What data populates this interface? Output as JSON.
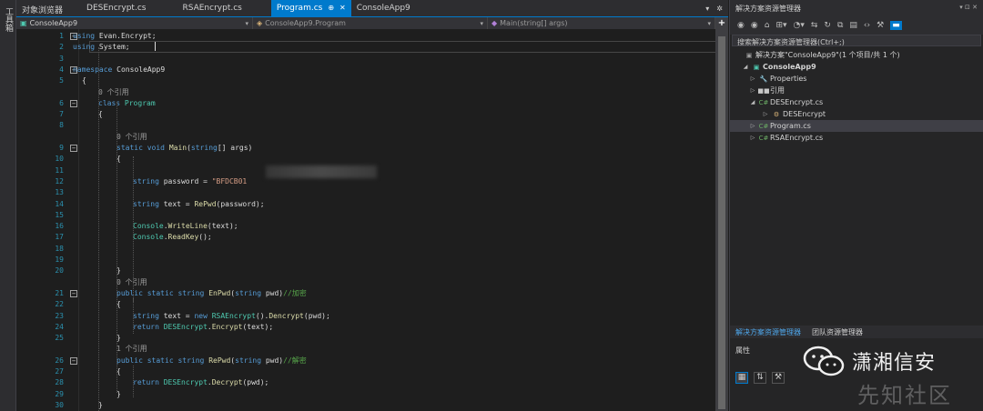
{
  "toolbox": {
    "label": "工具箱"
  },
  "tabs": [
    {
      "label": "对象浏览器"
    },
    {
      "label": "DESEncrypt.cs"
    },
    {
      "label": "RSAEncrypt.cs"
    },
    {
      "label": "Program.cs",
      "pin": "⊕",
      "close": "✕"
    },
    {
      "label": "ConsoleApp9"
    }
  ],
  "tabbar_right": {
    "dropdown": "▾",
    "settings": "✲"
  },
  "navbar": {
    "project": "ConsoleApp9",
    "class": "ConsoleApp9.Program",
    "member": "Main(string[] args)",
    "add": "+"
  },
  "code_lines": [
    {
      "n": "1",
      "parts": [
        [
          "kw",
          "using"
        ],
        [
          "pl",
          " Evan.Encrypt;"
        ]
      ]
    },
    {
      "n": "2",
      "parts": [
        [
          "kw",
          "using"
        ],
        [
          "pl",
          " System;"
        ]
      ]
    },
    {
      "n": "3",
      "parts": []
    },
    {
      "n": "4",
      "parts": [
        [
          "kw",
          "namespace"
        ],
        [
          "pl",
          " ConsoleApp9"
        ]
      ]
    },
    {
      "n": "5",
      "parts": [
        [
          "pl",
          "{"
        ]
      ]
    },
    {
      "n": "",
      "parts": [
        [
          "ref",
          "0 个引用"
        ]
      ]
    },
    {
      "n": "6",
      "parts": [
        [
          "kw",
          "class"
        ],
        [
          "pl",
          " "
        ],
        [
          "ty",
          "Program"
        ]
      ]
    },
    {
      "n": "7",
      "parts": [
        [
          "pl",
          "{"
        ]
      ]
    },
    {
      "n": "8",
      "parts": []
    },
    {
      "n": "",
      "parts": [
        [
          "ref",
          "0 个引用"
        ]
      ]
    },
    {
      "n": "9",
      "parts": [
        [
          "kw",
          "static"
        ],
        [
          "pl",
          " "
        ],
        [
          "kw",
          "void"
        ],
        [
          "pl",
          " "
        ],
        [
          "mt",
          "Main"
        ],
        [
          "pl",
          "("
        ],
        [
          "kw",
          "string"
        ],
        [
          "pl",
          "[] args)"
        ]
      ]
    },
    {
      "n": "10",
      "parts": [
        [
          "pl",
          "{"
        ]
      ]
    },
    {
      "n": "11",
      "parts": []
    },
    {
      "n": "12",
      "parts": [
        [
          "kw",
          "string"
        ],
        [
          "pl",
          " password = "
        ],
        [
          "st",
          "\"BFDCB01"
        ]
      ]
    },
    {
      "n": "13",
      "parts": []
    },
    {
      "n": "14",
      "parts": [
        [
          "kw",
          "string"
        ],
        [
          "pl",
          " text = "
        ],
        [
          "mt",
          "RePwd"
        ],
        [
          "pl",
          "(password);"
        ]
      ]
    },
    {
      "n": "15",
      "parts": []
    },
    {
      "n": "16",
      "parts": [
        [
          "ty",
          "Console"
        ],
        [
          "pl",
          "."
        ],
        [
          "mt",
          "WriteLine"
        ],
        [
          "pl",
          "(text);"
        ]
      ]
    },
    {
      "n": "17",
      "parts": [
        [
          "ty",
          "Console"
        ],
        [
          "pl",
          "."
        ],
        [
          "mt",
          "ReadKey"
        ],
        [
          "pl",
          "();"
        ]
      ]
    },
    {
      "n": "18",
      "parts": []
    },
    {
      "n": "19",
      "parts": []
    },
    {
      "n": "20",
      "parts": [
        [
          "pl",
          "}"
        ]
      ]
    },
    {
      "n": "",
      "parts": [
        [
          "ref",
          "0 个引用"
        ]
      ]
    },
    {
      "n": "21",
      "parts": [
        [
          "kw",
          "public"
        ],
        [
          "pl",
          " "
        ],
        [
          "kw",
          "static"
        ],
        [
          "pl",
          " "
        ],
        [
          "kw",
          "string"
        ],
        [
          "pl",
          " "
        ],
        [
          "mt",
          "EnPwd"
        ],
        [
          "pl",
          "("
        ],
        [
          "kw",
          "string"
        ],
        [
          "pl",
          " pwd)"
        ],
        [
          "cm",
          "//加密"
        ]
      ]
    },
    {
      "n": "22",
      "parts": [
        [
          "pl",
          "{"
        ]
      ]
    },
    {
      "n": "23",
      "parts": [
        [
          "kw",
          "string"
        ],
        [
          "pl",
          " text = "
        ],
        [
          "kw",
          "new"
        ],
        [
          "pl",
          " "
        ],
        [
          "ty",
          "RSAEncrypt"
        ],
        [
          "pl",
          "()."
        ],
        [
          "mt",
          "Dencrypt"
        ],
        [
          "pl",
          "(pwd);"
        ]
      ]
    },
    {
      "n": "24",
      "parts": [
        [
          "kw",
          "return"
        ],
        [
          "pl",
          " "
        ],
        [
          "ty",
          "DESEncrypt"
        ],
        [
          "pl",
          "."
        ],
        [
          "mt",
          "Encrypt"
        ],
        [
          "pl",
          "(text);"
        ]
      ]
    },
    {
      "n": "25",
      "parts": [
        [
          "pl",
          "}"
        ]
      ]
    },
    {
      "n": "",
      "parts": [
        [
          "ref",
          "1 个引用"
        ]
      ]
    },
    {
      "n": "26",
      "parts": [
        [
          "kw",
          "public"
        ],
        [
          "pl",
          " "
        ],
        [
          "kw",
          "static"
        ],
        [
          "pl",
          " "
        ],
        [
          "kw",
          "string"
        ],
        [
          "pl",
          " "
        ],
        [
          "mt",
          "RePwd"
        ],
        [
          "pl",
          "("
        ],
        [
          "kw",
          "string"
        ],
        [
          "pl",
          " pwd)"
        ],
        [
          "cm",
          "//解密"
        ]
      ]
    },
    {
      "n": "27",
      "parts": [
        [
          "pl",
          "{"
        ]
      ]
    },
    {
      "n": "28",
      "parts": [
        [
          "kw",
          "return"
        ],
        [
          "pl",
          " "
        ],
        [
          "ty",
          "DESEncrypt"
        ],
        [
          "pl",
          "."
        ],
        [
          "mt",
          "Decrypt"
        ],
        [
          "pl",
          "(pwd);"
        ]
      ]
    },
    {
      "n": "29",
      "parts": [
        [
          "pl",
          "}"
        ]
      ]
    },
    {
      "n": "30",
      "parts": [
        [
          "pl",
          "}"
        ]
      ]
    },
    {
      "n": "31",
      "parts": [
        [
          "pl",
          "}"
        ]
      ]
    }
  ],
  "solution_explorer": {
    "title": "解决方案资源管理器",
    "title_controls": "▾ ⊡ ✕",
    "search_placeholder": "搜索解决方案资源管理器(Ctrl+;)",
    "tree": [
      {
        "label": "解决方案\"ConsoleApp9\"(1 个项目/共 1 个)",
        "icon": "▣"
      },
      {
        "label": "ConsoleApp9",
        "icon": "▣",
        "arrow": "◢"
      },
      {
        "label": "Properties",
        "icon": "🔧",
        "arrow": "▷"
      },
      {
        "label": "引用",
        "icon": "■■",
        "arrow": "▷"
      },
      {
        "label": "DESEncrypt.cs",
        "icon": "C#",
        "arrow": "◢"
      },
      {
        "label": "DESEncrypt",
        "icon": "⚙",
        "arrow": "▷"
      },
      {
        "label": "Program.cs",
        "icon": "C#",
        "arrow": "▷"
      },
      {
        "label": "RSAEncrypt.cs",
        "icon": "C#",
        "arrow": "▷"
      }
    ],
    "tabs": [
      "解决方案资源管理器",
      "团队资源管理器"
    ],
    "properties_title": "属性"
  },
  "watermark": {
    "line1": "潇湘信安",
    "line2": "先知社区"
  }
}
